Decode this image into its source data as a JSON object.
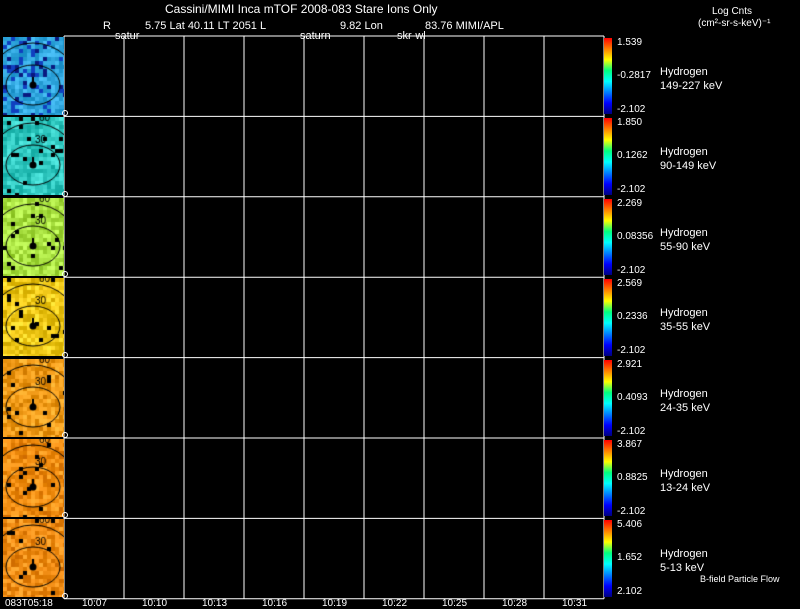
{
  "header": {
    "title": "Cassini/MIMI Inca mTOF  2008-083   Stare   Ions Only",
    "r_label": "R",
    "r_value": "5.75 Lat 40.11 LT 2051 L",
    "l_value": "9.82 Lon",
    "lon_value": "83.76  MIMI/APL",
    "sub1": "satur",
    "sub2": "saturn",
    "sub3": "skr-wl",
    "units_title": "Log Cnts",
    "units_sub": "(cm²-sr-s-keV)⁻¹"
  },
  "footer_note": "B-field Particle Flow",
  "time_ticks": [
    "083T05:18",
    "10:07",
    "10:10",
    "10:13",
    "10:16",
    "10:19",
    "10:22",
    "10:25",
    "10:28",
    "10:31"
  ],
  "panels": [
    {
      "species": "Hydrogen",
      "energy": "149-227 keV",
      "max": "1.539",
      "mid": "-0.2817",
      "min": "-2.102",
      "ring1": "",
      "ring2": "",
      "tone": "#2aa0d8"
    },
    {
      "species": "Hydrogen",
      "energy": "90-149 keV",
      "max": "1.850",
      "mid": "0.1262",
      "min": "-2.102",
      "ring1": "30",
      "ring2": "60",
      "tone": "#30c8c0"
    },
    {
      "species": "Hydrogen",
      "energy": "55-90 keV",
      "max": "2.269",
      "mid": "0.08356",
      "min": "-2.102",
      "ring1": "30",
      "ring2": "60",
      "tone": "#a8e040"
    },
    {
      "species": "Hydrogen",
      "energy": "35-55 keV",
      "max": "2.569",
      "mid": "0.2336",
      "min": "-2.102",
      "ring1": "30",
      "ring2": "60",
      "tone": "#f0c818"
    },
    {
      "species": "Hydrogen",
      "energy": "24-35 keV",
      "max": "2.921",
      "mid": "0.4093",
      "min": "-2.102",
      "ring1": "30",
      "ring2": "60",
      "tone": "#f09a18"
    },
    {
      "species": "Hydrogen",
      "energy": "13-24 keV",
      "max": "3.867",
      "mid": "0.8825",
      "min": "-2.102",
      "ring1": "30",
      "ring2": "60",
      "tone": "#f08c10"
    },
    {
      "species": "Hydrogen",
      "energy": "5-13 keV",
      "max": "5.406",
      "mid": "1.652",
      "min": "2.102",
      "ring1": "30",
      "ring2": "60",
      "tone": "#ee8a12"
    }
  ],
  "chart_data": {
    "type": "heatmap",
    "title": "Cassini/MIMI Inca mTOF  2008-083   Stare   Ions Only",
    "x_ticks": [
      "083T05:18",
      "10:07",
      "10:10",
      "10:13",
      "10:16",
      "10:19",
      "10:22",
      "10:25",
      "10:28",
      "10:31"
    ],
    "colorbar_label": "Log Cnts (cm²-sr-s-keV)⁻¹",
    "grid": true,
    "series": [
      {
        "name": "Hydrogen 149-227 keV",
        "min": -2.102,
        "mid": -0.2817,
        "max": 1.539
      },
      {
        "name": "Hydrogen 90-149 keV",
        "min": -2.102,
        "mid": 0.1262,
        "max": 1.85
      },
      {
        "name": "Hydrogen 55-90 keV",
        "min": -2.102,
        "mid": 0.08356,
        "max": 2.269
      },
      {
        "name": "Hydrogen 35-55 keV",
        "min": -2.102,
        "mid": 0.2336,
        "max": 2.569
      },
      {
        "name": "Hydrogen 24-35 keV",
        "min": -2.102,
        "mid": 0.4093,
        "max": 2.921
      },
      {
        "name": "Hydrogen 13-24 keV",
        "min": -2.102,
        "mid": 0.8825,
        "max": 3.867
      },
      {
        "name": "Hydrogen 5-13 keV",
        "min": 2.102,
        "mid": 1.652,
        "max": 5.406
      }
    ]
  }
}
